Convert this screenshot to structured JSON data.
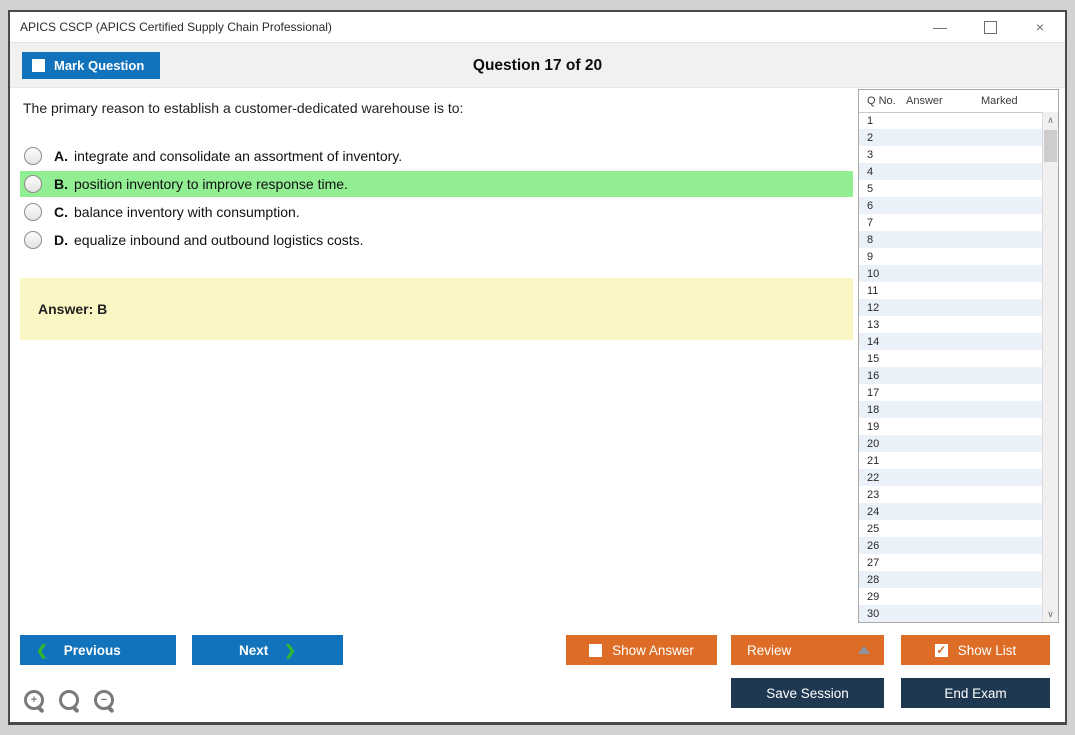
{
  "window": {
    "title": "APICS CSCP (APICS Certified Supply Chain Professional)",
    "controls": {
      "minimize": "—",
      "close": "×"
    }
  },
  "header": {
    "mark_question": {
      "label": "Mark Question",
      "checked": false
    },
    "question_counter": "Question 17 of 20"
  },
  "question": {
    "text": "The primary reason to establish a customer-dedicated warehouse is to:",
    "options": [
      {
        "letter": "A.",
        "text": "integrate and consolidate an assortment of inventory.",
        "highlighted": false
      },
      {
        "letter": "B.",
        "text": "position inventory to improve response time.",
        "highlighted": true
      },
      {
        "letter": "C.",
        "text": "balance inventory with consumption.",
        "highlighted": false
      },
      {
        "letter": "D.",
        "text": "equalize inbound and outbound logistics costs.",
        "highlighted": false
      }
    ],
    "answer_text": "Answer: B"
  },
  "sidebar": {
    "columns": [
      "Q No.",
      "Answer",
      "Marked"
    ],
    "rows": [
      {
        "q": "1",
        "answer": "",
        "marked": ""
      },
      {
        "q": "2",
        "answer": "",
        "marked": ""
      },
      {
        "q": "3",
        "answer": "",
        "marked": ""
      },
      {
        "q": "4",
        "answer": "",
        "marked": ""
      },
      {
        "q": "5",
        "answer": "",
        "marked": ""
      },
      {
        "q": "6",
        "answer": "",
        "marked": ""
      },
      {
        "q": "7",
        "answer": "",
        "marked": ""
      },
      {
        "q": "8",
        "answer": "",
        "marked": ""
      },
      {
        "q": "9",
        "answer": "",
        "marked": ""
      },
      {
        "q": "10",
        "answer": "",
        "marked": ""
      },
      {
        "q": "11",
        "answer": "",
        "marked": ""
      },
      {
        "q": "12",
        "answer": "",
        "marked": ""
      },
      {
        "q": "13",
        "answer": "",
        "marked": ""
      },
      {
        "q": "14",
        "answer": "",
        "marked": ""
      },
      {
        "q": "15",
        "answer": "",
        "marked": ""
      },
      {
        "q": "16",
        "answer": "",
        "marked": ""
      },
      {
        "q": "17",
        "answer": "",
        "marked": ""
      },
      {
        "q": "18",
        "answer": "",
        "marked": ""
      },
      {
        "q": "19",
        "answer": "",
        "marked": ""
      },
      {
        "q": "20",
        "answer": "",
        "marked": ""
      },
      {
        "q": "21",
        "answer": "",
        "marked": ""
      },
      {
        "q": "22",
        "answer": "",
        "marked": ""
      },
      {
        "q": "23",
        "answer": "",
        "marked": ""
      },
      {
        "q": "24",
        "answer": "",
        "marked": ""
      },
      {
        "q": "25",
        "answer": "",
        "marked": ""
      },
      {
        "q": "26",
        "answer": "",
        "marked": ""
      },
      {
        "q": "27",
        "answer": "",
        "marked": ""
      },
      {
        "q": "28",
        "answer": "",
        "marked": ""
      },
      {
        "q": "29",
        "answer": "",
        "marked": ""
      },
      {
        "q": "30",
        "answer": "",
        "marked": ""
      }
    ]
  },
  "footer": {
    "previous": "Previous",
    "next": "Next",
    "show_answer": {
      "label": "Show Answer",
      "checked": false
    },
    "review": "Review",
    "show_list": {
      "label": "Show List",
      "checked": true
    },
    "save_session": "Save Session",
    "end_exam": "End Exam",
    "prev_chevron": "❮",
    "next_chevron": "❯",
    "scroll_up_glyph": "∧",
    "scroll_down_glyph": "∨",
    "zoom_in_sign": "+",
    "zoom_out_sign": "−"
  },
  "colors": {
    "accent_blue": "#1173bc",
    "accent_orange": "#dd6c27",
    "accent_navy": "#1e3851",
    "highlight_green": "#92ee92",
    "answer_yellow": "#faf7c5",
    "row_alt_blue": "#eaf1f8"
  }
}
